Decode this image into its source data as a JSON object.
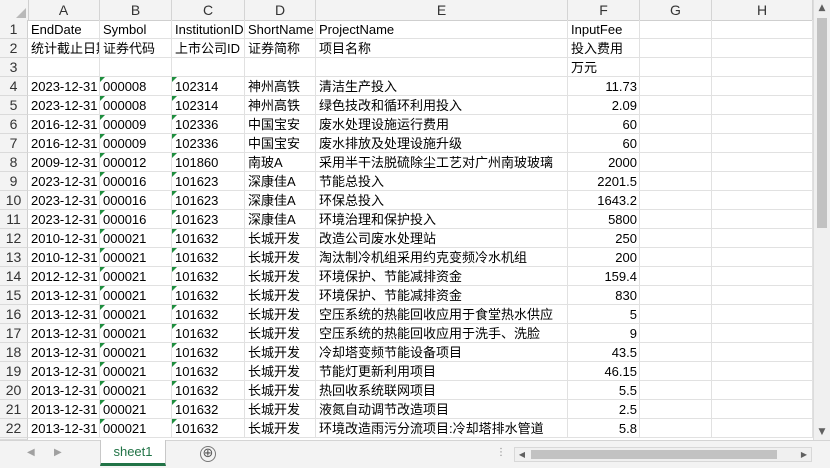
{
  "columns": [
    "A",
    "B",
    "C",
    "D",
    "E",
    "F",
    "G",
    "H"
  ],
  "rows": [
    [
      "EndDate",
      "Symbol",
      "InstitutionID",
      "ShortName",
      "ProjectName",
      "InputFee",
      "",
      ""
    ],
    [
      "统计截止日期",
      "证券代码",
      "上市公司ID",
      "证券简称",
      "项目名称",
      "投入费用",
      "",
      ""
    ],
    [
      "",
      "",
      "",
      "",
      "",
      "万元",
      "",
      ""
    ],
    [
      "2023-12-31",
      "000008",
      "102314",
      "神州高铁",
      "清洁生产投入",
      "11.73",
      "",
      ""
    ],
    [
      "2023-12-31",
      "000008",
      "102314",
      "神州高铁",
      "绿色技改和循环利用投入",
      "2.09",
      "",
      ""
    ],
    [
      "2016-12-31",
      "000009",
      "102336",
      "中国宝安",
      "废水处理设施运行费用",
      "60",
      "",
      ""
    ],
    [
      "2016-12-31",
      "000009",
      "102336",
      "中国宝安",
      "废水排放及处理设施升级",
      "60",
      "",
      ""
    ],
    [
      "2009-12-31",
      "000012",
      "101860",
      "南玻A",
      "采用半干法脱硫除尘工艺对广州南玻玻璃",
      "2000",
      "",
      ""
    ],
    [
      "2023-12-31",
      "000016",
      "101623",
      "深康佳A",
      "节能总投入",
      "2201.5",
      "",
      ""
    ],
    [
      "2023-12-31",
      "000016",
      "101623",
      "深康佳A",
      "环保总投入",
      "1643.2",
      "",
      ""
    ],
    [
      "2023-12-31",
      "000016",
      "101623",
      "深康佳A",
      "环境治理和保护投入",
      "5800",
      "",
      ""
    ],
    [
      "2010-12-31",
      "000021",
      "101632",
      "长城开发",
      "改造公司废水处理站",
      "250",
      "",
      ""
    ],
    [
      "2010-12-31",
      "000021",
      "101632",
      "长城开发",
      "淘汰制冷机组采用约克变频冷水机组",
      "200",
      "",
      ""
    ],
    [
      "2012-12-31",
      "000021",
      "101632",
      "长城开发",
      "环境保护、节能减排资金",
      "159.4",
      "",
      ""
    ],
    [
      "2013-12-31",
      "000021",
      "101632",
      "长城开发",
      "环境保护、节能减排资金",
      "830",
      "",
      ""
    ],
    [
      "2013-12-31",
      "000021",
      "101632",
      "长城开发",
      "空压系统的热能回收应用于食堂热水供应",
      "5",
      "",
      ""
    ],
    [
      "2013-12-31",
      "000021",
      "101632",
      "长城开发",
      "空压系统的热能回收应用于洗手、洗脸",
      "9",
      "",
      ""
    ],
    [
      "2013-12-31",
      "000021",
      "101632",
      "长城开发",
      "冷却塔变频节能设备项目",
      "43.5",
      "",
      ""
    ],
    [
      "2013-12-31",
      "000021",
      "101632",
      "长城开发",
      "节能灯更新利用项目",
      "46.15",
      "",
      ""
    ],
    [
      "2013-12-31",
      "000021",
      "101632",
      "长城开发",
      "热回收系统联网项目",
      "5.5",
      "",
      ""
    ],
    [
      "2013-12-31",
      "000021",
      "101632",
      "长城开发",
      "液氮自动调节改造项目",
      "2.5",
      "",
      ""
    ],
    [
      "2013-12-31",
      "000021",
      "101632",
      "长城开发",
      "环境改造雨污分流项目:冷却塔排水管道",
      "5.8",
      "",
      ""
    ]
  ],
  "sheet_tab": "sheet1",
  "add_sheet_symbol": "⊕",
  "separator": "⋮",
  "icons": {
    "scroll_up": "scroll-up-arrow-icon",
    "scroll_down": "scroll-down-arrow-icon",
    "scroll_left": "scroll-left-arrow-icon",
    "scroll_right": "scroll-right-arrow-icon",
    "tab_prev": "tab-prev-arrow-icon",
    "tab_next": "tab-next-arrow-icon",
    "corner": "select-all-corner-icon"
  },
  "colors": {
    "accent": "#217346",
    "number_marker": "#1e8e3e",
    "header_bg": "#f3f3f3"
  }
}
